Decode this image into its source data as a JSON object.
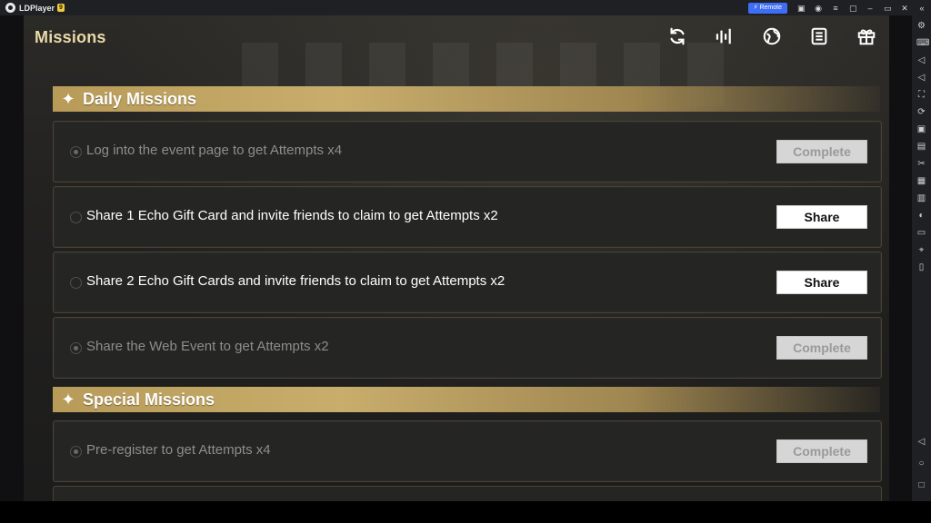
{
  "emulator": {
    "title": "LDPlayer",
    "version_badge": "9",
    "remote_label": "Remote"
  },
  "game": {
    "page_title": "Missions",
    "top_icons": [
      "refresh-icon",
      "audio-bars-icon",
      "globe-icon",
      "list-icon",
      "gift-icon"
    ],
    "sections": [
      {
        "title": "Daily Missions",
        "missions": [
          {
            "text": "Log into the event page to get Attempts x4",
            "button": "Complete",
            "state": "done"
          },
          {
            "text": "Share 1 Echo Gift Card and invite friends to claim to get Attempts x2",
            "button": "Share",
            "state": "active"
          },
          {
            "text": "Share 2 Echo Gift Cards and invite friends to claim to get Attempts x2",
            "button": "Share",
            "state": "active"
          },
          {
            "text": "Share the Web Event to get Attempts x2",
            "button": "Complete",
            "state": "done"
          }
        ]
      },
      {
        "title": "Special Missions",
        "missions": [
          {
            "text": "Pre-register to get Attempts x4",
            "button": "Complete",
            "state": "done"
          }
        ]
      }
    ]
  },
  "colors": {
    "accent_gold": "#c8ad6c",
    "title_gold": "#ead9a9",
    "remote_blue": "#3e6ef4"
  }
}
